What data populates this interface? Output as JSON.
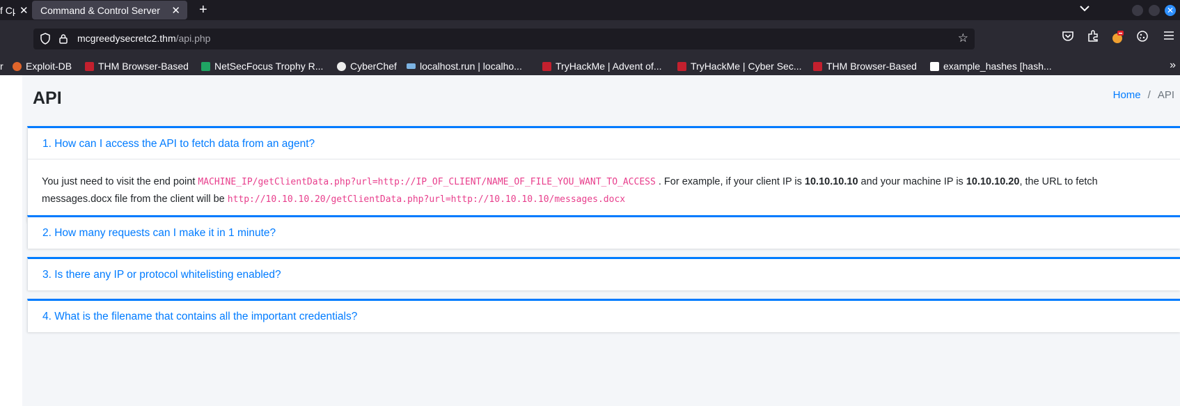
{
  "browser": {
    "tabs": [
      {
        "title": "f Cµ",
        "close_label": "✕"
      },
      {
        "title": "Command & Control Server",
        "close_label": "✕"
      }
    ],
    "new_tab_label": "+",
    "tab_list_label": "⌄",
    "window_close_label": "✕",
    "url_host": "mcgreedysecretc2.thm",
    "url_path": "/api.php",
    "bookmarks": [
      {
        "label": "r",
        "icon": "folder-icon"
      },
      {
        "label": "Exploit-DB",
        "icon": "exploit-db-icon",
        "color": "#e0652b"
      },
      {
        "label": "THM Browser-Based",
        "icon": "thm-icon",
        "color": "#c3202e"
      },
      {
        "label": "NetSecFocus Trophy R...",
        "icon": "sheets-icon",
        "color": "#1fa463"
      },
      {
        "label": "CyberChef",
        "icon": "chef-hat-icon",
        "color": "#ededed"
      },
      {
        "label": "localhost.run | localho...",
        "icon": "localhost-icon",
        "color": "#7cb3e3"
      },
      {
        "label": "TryHackMe | Advent of...",
        "icon": "thm-icon",
        "color": "#c3202e"
      },
      {
        "label": "TryHackMe | Cyber Sec...",
        "icon": "thm-icon",
        "color": "#c3202e"
      },
      {
        "label": "THM Browser-Based",
        "icon": "thm-icon",
        "color": "#c3202e"
      },
      {
        "label": "example_hashes [hash...",
        "icon": "hashcat-icon",
        "color": "#ffffff"
      }
    ],
    "bookmarks_overflow_label": "»"
  },
  "page": {
    "title": "API",
    "breadcrumb": {
      "home": "Home",
      "separator": "/",
      "current": "API"
    }
  },
  "faq": [
    {
      "question": "1. How can I access the API to fetch data from an agent?",
      "expanded": true,
      "answer": {
        "p1": "You just need to visit the end point ",
        "endpoint": "MACHINE_IP/getClientData.php?url=http://IP_OF_CLIENT/NAME_OF_FILE_YOU_WANT_TO_ACCESS",
        "p2": " . For example, if your client IP is ",
        "client_ip": "10.10.10.10",
        "p3": " and your machine IP is ",
        "machine_ip": "10.10.10.20",
        "p4": ", the URL to fetch messages.docx file from the client will be ",
        "example_url": "http://10.10.10.20/getClientData.php?url=http://10.10.10.10/messages.docx"
      }
    },
    {
      "question": "2. How many requests can I make it in 1 minute?",
      "expanded": false
    },
    {
      "question": "3. Is there any IP or protocol whitelisting enabled?",
      "expanded": false
    },
    {
      "question": "4. What is the filename that contains all the important credentials?",
      "expanded": false
    }
  ],
  "colors": {
    "accent": "#007bff",
    "code": "#e83e8c",
    "chrome_dark": "#1c1b22",
    "chrome": "#2b2a33"
  }
}
